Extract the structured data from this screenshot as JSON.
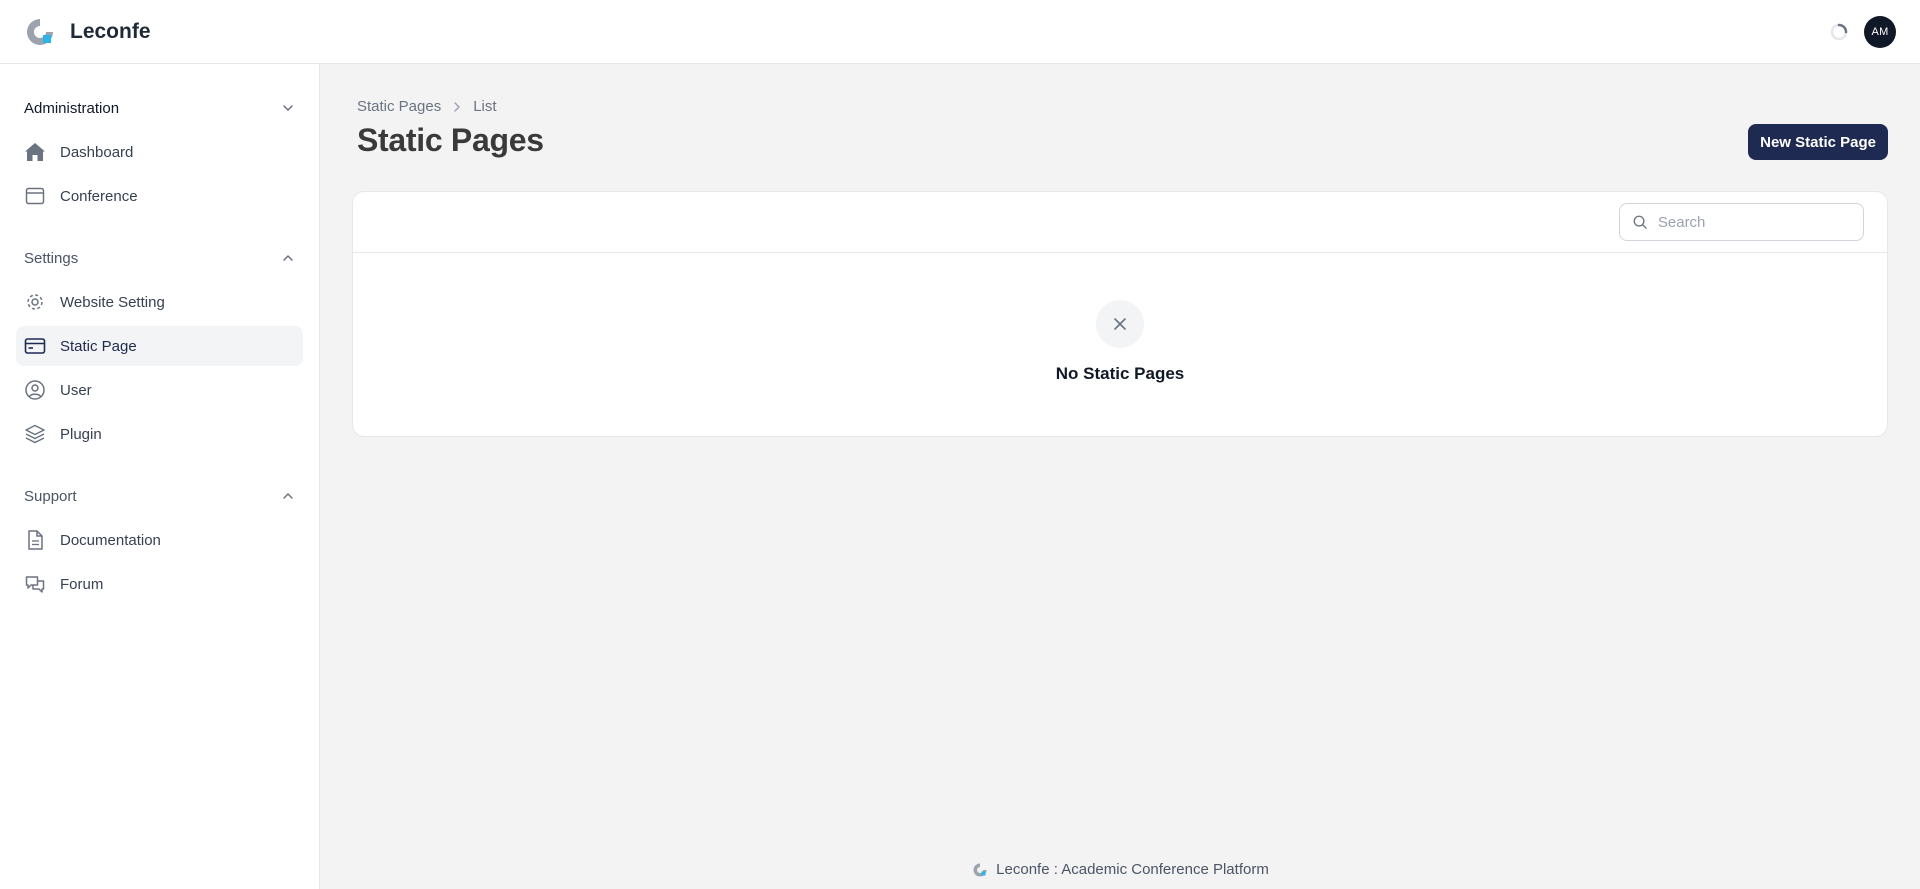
{
  "app": {
    "name": "Leconfe"
  },
  "user": {
    "initials": "AM"
  },
  "colors": {
    "accent": "#1e2a51",
    "brand_cyan": "#2bb5e6",
    "brand_gray": "#6b7280"
  },
  "sidebar": {
    "groups": [
      {
        "label": "Administration",
        "collapsed_icon": "chevron-down-icon",
        "items": [
          {
            "label": "Dashboard",
            "icon": "home-icon"
          },
          {
            "label": "Conference",
            "icon": "calendar-icon"
          }
        ]
      },
      {
        "label": "Settings",
        "collapsed_icon": "chevron-up-icon",
        "items": [
          {
            "label": "Website Setting",
            "icon": "gear-icon"
          },
          {
            "label": "Static Page",
            "icon": "card-icon",
            "active": true
          },
          {
            "label": "User",
            "icon": "user-circle-icon"
          },
          {
            "label": "Plugin",
            "icon": "layers-icon"
          }
        ]
      },
      {
        "label": "Support",
        "collapsed_icon": "chevron-up-icon",
        "items": [
          {
            "label": "Documentation",
            "icon": "document-icon"
          },
          {
            "label": "Forum",
            "icon": "chat-icon"
          }
        ]
      }
    ]
  },
  "breadcrumb": {
    "items": [
      "Static Pages",
      "List"
    ]
  },
  "page": {
    "title": "Static Pages",
    "new_button": "New Static Page"
  },
  "table": {
    "search_placeholder": "Search",
    "empty_text": "No Static Pages"
  },
  "footer": {
    "text": "Leconfe : Academic Conference Platform"
  }
}
